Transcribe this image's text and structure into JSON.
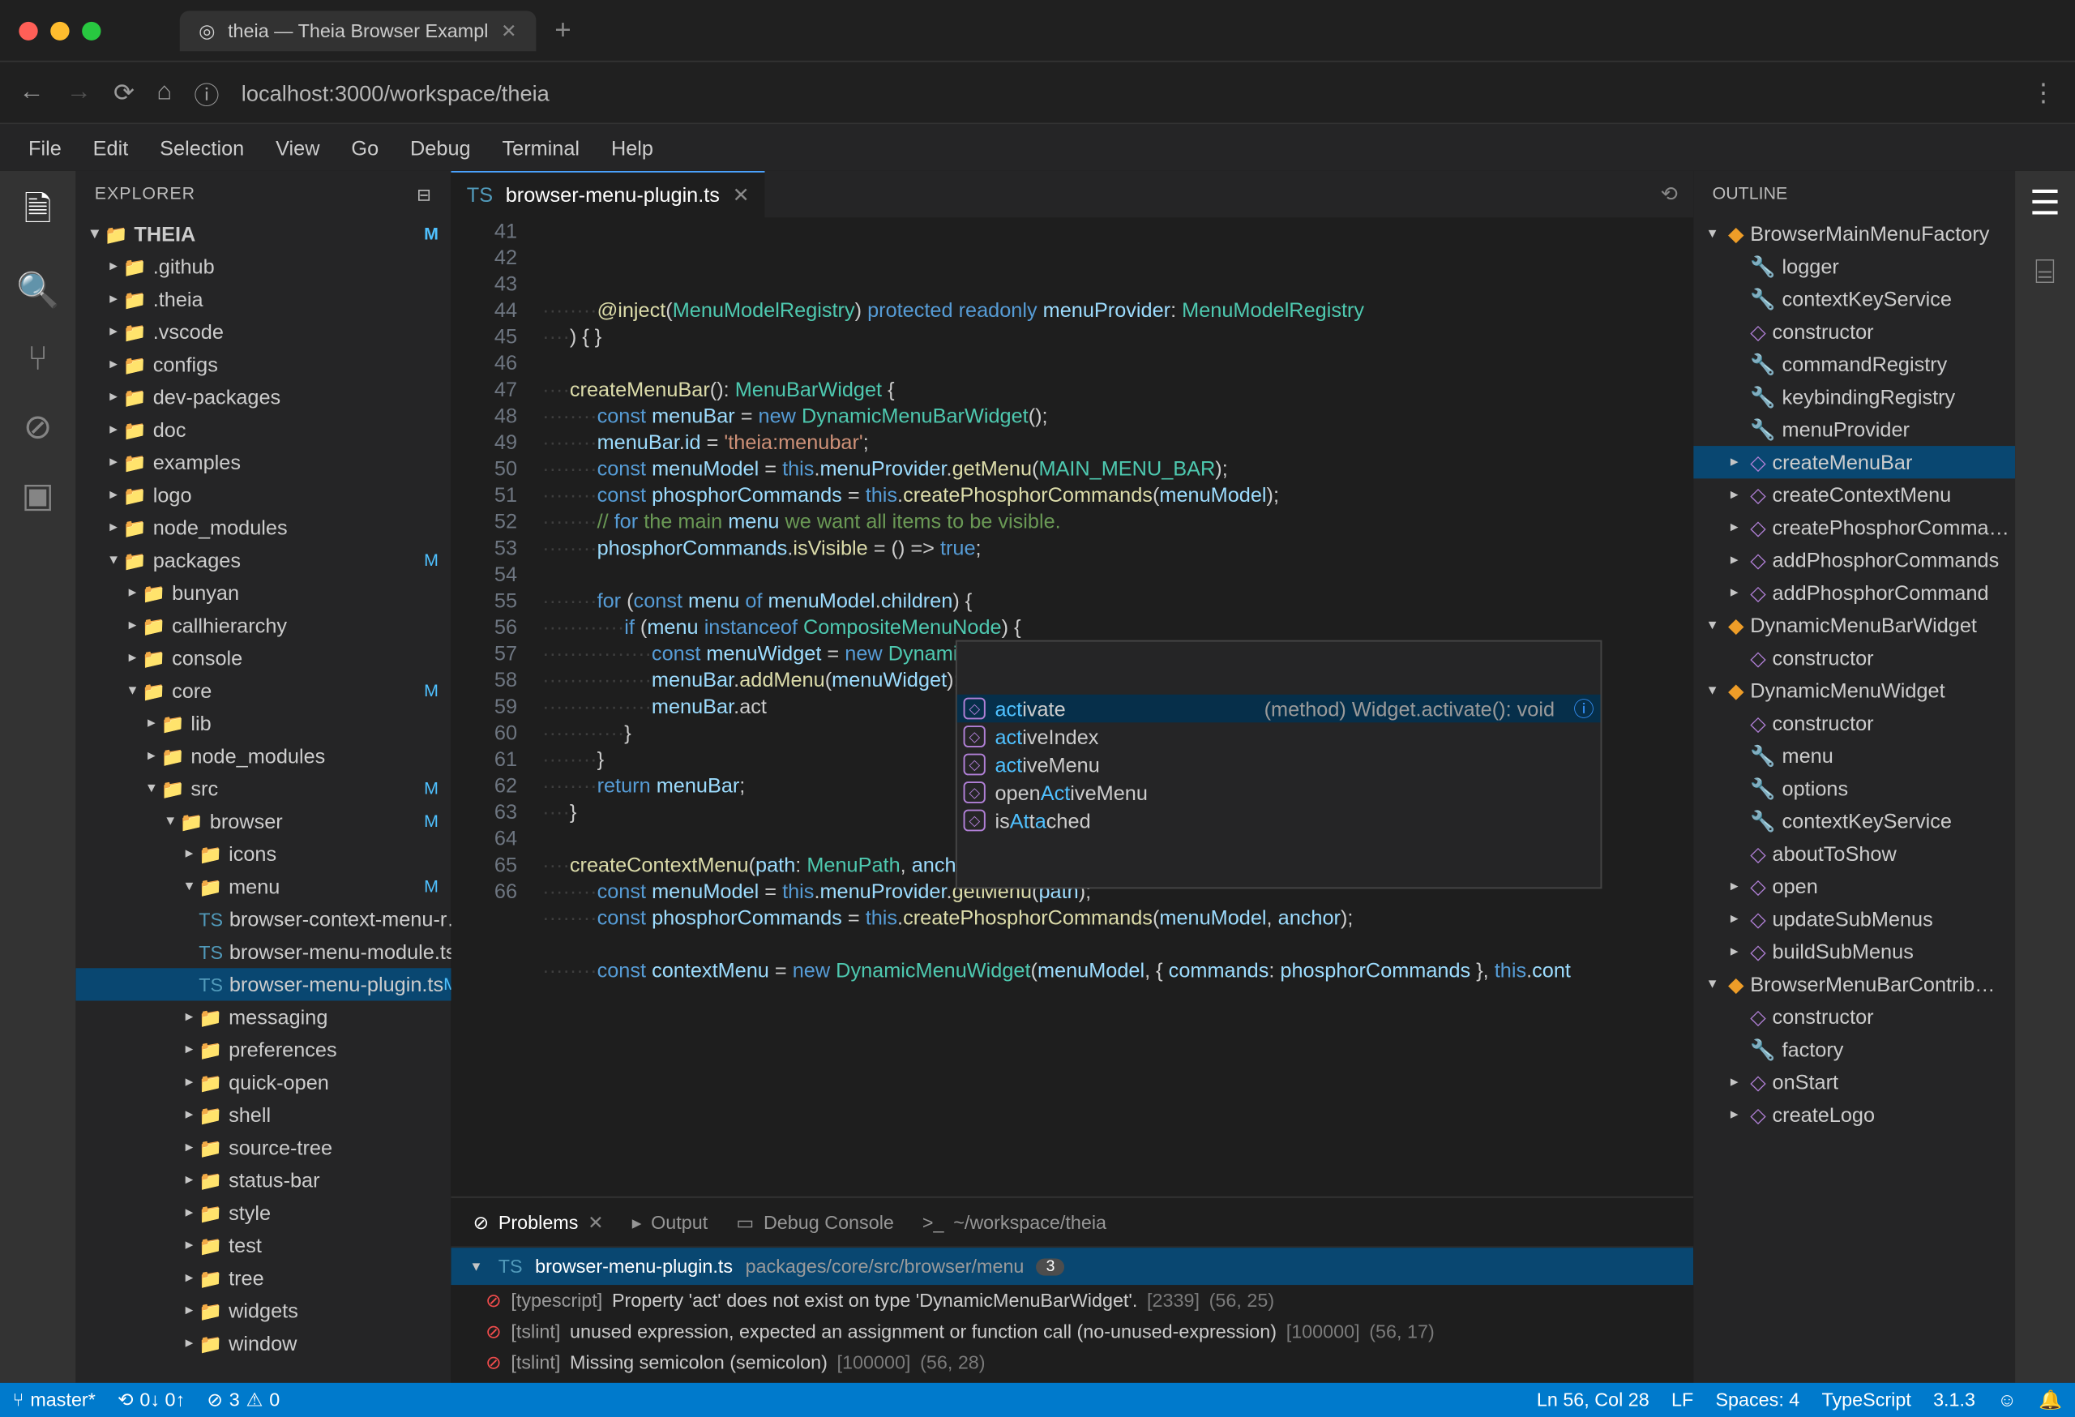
{
  "browser": {
    "tab_title": "theia — Theia Browser Exampl",
    "url": "localhost:3000/workspace/theia"
  },
  "menubar": [
    "File",
    "Edit",
    "Selection",
    "View",
    "Go",
    "Debug",
    "Terminal",
    "Help"
  ],
  "explorer": {
    "title": "EXPLORER",
    "root": "THEIA",
    "root_mod": "M",
    "tree": [
      {
        "d": 1,
        "t": "folder",
        "n": ".github",
        "exp": false
      },
      {
        "d": 1,
        "t": "folder",
        "n": ".theia",
        "exp": false
      },
      {
        "d": 1,
        "t": "folder",
        "n": ".vscode",
        "exp": false
      },
      {
        "d": 1,
        "t": "folder",
        "n": "configs",
        "exp": false
      },
      {
        "d": 1,
        "t": "folder",
        "n": "dev-packages",
        "exp": false
      },
      {
        "d": 1,
        "t": "folder",
        "n": "doc",
        "exp": false
      },
      {
        "d": 1,
        "t": "folder",
        "n": "examples",
        "exp": false
      },
      {
        "d": 1,
        "t": "folder",
        "n": "logo",
        "exp": false
      },
      {
        "d": 1,
        "t": "folder",
        "n": "node_modules",
        "exp": false
      },
      {
        "d": 1,
        "t": "folder",
        "n": "packages",
        "exp": true,
        "m": "M"
      },
      {
        "d": 2,
        "t": "folder",
        "n": "bunyan",
        "exp": false
      },
      {
        "d": 2,
        "t": "folder",
        "n": "callhierarchy",
        "exp": false
      },
      {
        "d": 2,
        "t": "folder",
        "n": "console",
        "exp": false
      },
      {
        "d": 2,
        "t": "folder",
        "n": "core",
        "exp": true,
        "m": "M"
      },
      {
        "d": 3,
        "t": "folder",
        "n": "lib",
        "exp": false
      },
      {
        "d": 3,
        "t": "folder",
        "n": "node_modules",
        "exp": false
      },
      {
        "d": 3,
        "t": "folder",
        "n": "src",
        "exp": true,
        "m": "M"
      },
      {
        "d": 4,
        "t": "folder",
        "n": "browser",
        "exp": true,
        "m": "M"
      },
      {
        "d": 5,
        "t": "folder",
        "n": "icons",
        "exp": false
      },
      {
        "d": 5,
        "t": "folder",
        "n": "menu",
        "exp": true,
        "m": "M"
      },
      {
        "d": 6,
        "t": "file",
        "n": "browser-context-menu-r…"
      },
      {
        "d": 6,
        "t": "file",
        "n": "browser-menu-module.ts"
      },
      {
        "d": 6,
        "t": "file",
        "n": "browser-menu-plugin.ts",
        "m": "M",
        "sel": true
      },
      {
        "d": 5,
        "t": "folder",
        "n": "messaging",
        "exp": false
      },
      {
        "d": 5,
        "t": "folder",
        "n": "preferences",
        "exp": false
      },
      {
        "d": 5,
        "t": "folder",
        "n": "quick-open",
        "exp": false
      },
      {
        "d": 5,
        "t": "folder",
        "n": "shell",
        "exp": false
      },
      {
        "d": 5,
        "t": "folder",
        "n": "source-tree",
        "exp": false
      },
      {
        "d": 5,
        "t": "folder",
        "n": "status-bar",
        "exp": false
      },
      {
        "d": 5,
        "t": "folder",
        "n": "style",
        "exp": false
      },
      {
        "d": 5,
        "t": "folder",
        "n": "test",
        "exp": false
      },
      {
        "d": 5,
        "t": "folder",
        "n": "tree",
        "exp": false
      },
      {
        "d": 5,
        "t": "folder",
        "n": "widgets",
        "exp": false
      },
      {
        "d": 5,
        "t": "folder",
        "n": "window",
        "exp": false
      }
    ]
  },
  "editor": {
    "tab": "browser-menu-plugin.ts",
    "line_start": 41,
    "line_end": 66,
    "lines": [
      "        @inject(MenuModelRegistry) protected readonly menuProvider: MenuModelRegistry",
      "    ) { }",
      "",
      "    createMenuBar(): MenuBarWidget {",
      "        const menuBar = new DynamicMenuBarWidget();",
      "        menuBar.id = 'theia:menubar';",
      "        const menuModel = this.menuProvider.getMenu(MAIN_MENU_BAR);",
      "        const phosphorCommands = this.createPhosphorCommands(menuModel);",
      "        // for the main menu we want all items to be visible.",
      "        phosphorCommands.isVisible = () => true;",
      "",
      "        for (const menu of menuModel.children) {",
      "            if (menu instanceof CompositeMenuNode) {",
      "                const menuWidget = new DynamicMenuWidget(menu, { commands: phosphorCommands }, this.co",
      "                menuBar.addMenu(menuWidget);",
      "                menuBar.act",
      "            }",
      "        }",
      "        return menuBar;",
      "    }",
      "",
      "    createContextMenu(path: MenuPath, anchor?: Anchor): MenuWidget {",
      "        const menuModel = this.menuProvider.getMenu(path);",
      "        const phosphorCommands = this.createPhosphorCommands(menuModel, anchor);",
      "",
      "        const contextMenu = new DynamicMenuWidget(menuModel, { commands: phosphorCommands }, this.cont"
    ]
  },
  "suggest": {
    "doc": "(method) Widget.activate(): void",
    "items": [
      {
        "pre": "act",
        "rest": "ivate",
        "sel": true
      },
      {
        "pre": "act",
        "rest": "iveIndex"
      },
      {
        "pre": "act",
        "rest": "iveMenu"
      },
      {
        "pre": "",
        "mid_pre": "open",
        "mid_hl": "Act",
        "rest": "iveMenu"
      },
      {
        "pre": "",
        "mid_pre": "is",
        "mid_hl": "At",
        "mid_rest": "t",
        "mid_hl2": "a",
        "rest": "ched"
      }
    ]
  },
  "panel": {
    "tabs": [
      {
        "icon": "⊘",
        "label": "Problems",
        "active": true
      },
      {
        "icon": "▸",
        "label": "Output"
      },
      {
        "icon": "▭",
        "label": "Debug Console"
      },
      {
        "icon": ">_",
        "label": "~/workspace/theia"
      }
    ],
    "problem_file": "browser-menu-plugin.ts",
    "problem_path": "packages/core/src/browser/menu",
    "problem_count": "3",
    "problems": [
      {
        "src": "[typescript]",
        "msg": "Property 'act' does not exist on type 'DynamicMenuBarWidget'.",
        "code": "[2339]",
        "loc": "(56, 25)"
      },
      {
        "src": "[tslint]",
        "msg": "unused expression, expected an assignment or function call (no-unused-expression)",
        "code": "[100000]",
        "loc": "(56, 17)"
      },
      {
        "src": "[tslint]",
        "msg": "Missing semicolon (semicolon)",
        "code": "[100000]",
        "loc": "(56, 28)"
      }
    ]
  },
  "outline": {
    "title": "OUTLINE",
    "items": [
      {
        "d": 0,
        "k": "class",
        "n": "BrowserMainMenuFactory",
        "exp": true
      },
      {
        "d": 1,
        "k": "field",
        "n": "logger"
      },
      {
        "d": 1,
        "k": "field",
        "n": "contextKeyService"
      },
      {
        "d": 1,
        "k": "method",
        "n": "constructor"
      },
      {
        "d": 1,
        "k": "field",
        "n": "commandRegistry"
      },
      {
        "d": 1,
        "k": "field",
        "n": "keybindingRegistry"
      },
      {
        "d": 1,
        "k": "field",
        "n": "menuProvider"
      },
      {
        "d": 1,
        "k": "method",
        "n": "createMenuBar",
        "sel": true,
        "exp": false
      },
      {
        "d": 1,
        "k": "method",
        "n": "createContextMenu",
        "exp": false
      },
      {
        "d": 1,
        "k": "method",
        "n": "createPhosphorComma…",
        "exp": false
      },
      {
        "d": 1,
        "k": "method",
        "n": "addPhosphorCommands",
        "exp": false
      },
      {
        "d": 1,
        "k": "method",
        "n": "addPhosphorCommand",
        "exp": false
      },
      {
        "d": 0,
        "k": "class",
        "n": "DynamicMenuBarWidget",
        "exp": true
      },
      {
        "d": 1,
        "k": "method",
        "n": "constructor"
      },
      {
        "d": 0,
        "k": "class",
        "n": "DynamicMenuWidget",
        "exp": true
      },
      {
        "d": 1,
        "k": "method",
        "n": "constructor"
      },
      {
        "d": 1,
        "k": "field",
        "n": "menu"
      },
      {
        "d": 1,
        "k": "field",
        "n": "options"
      },
      {
        "d": 1,
        "k": "field",
        "n": "contextKeyService"
      },
      {
        "d": 1,
        "k": "method",
        "n": "aboutToShow"
      },
      {
        "d": 1,
        "k": "method",
        "n": "open",
        "exp": false
      },
      {
        "d": 1,
        "k": "method",
        "n": "updateSubMenus",
        "exp": false
      },
      {
        "d": 1,
        "k": "method",
        "n": "buildSubMenus",
        "exp": false
      },
      {
        "d": 0,
        "k": "class",
        "n": "BrowserMenuBarContrib…",
        "exp": true
      },
      {
        "d": 1,
        "k": "method",
        "n": "constructor"
      },
      {
        "d": 1,
        "k": "field",
        "n": "factory"
      },
      {
        "d": 1,
        "k": "method",
        "n": "onStart",
        "exp": false
      },
      {
        "d": 1,
        "k": "method",
        "n": "createLogo",
        "exp": false
      }
    ]
  },
  "status": {
    "branch": "master*",
    "sync": "0↓ 0↑",
    "errors": "3",
    "warnings": "0",
    "cursor": "Ln 56, Col 28",
    "eol": "LF",
    "indent": "Spaces: 4",
    "lang": "TypeScript",
    "version": "3.1.3"
  }
}
